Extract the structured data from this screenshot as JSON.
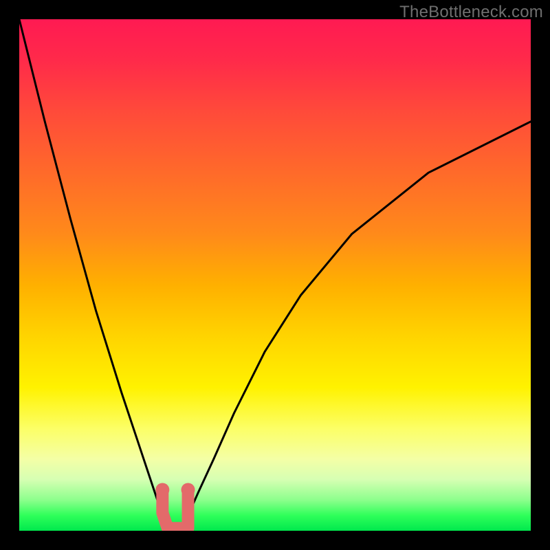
{
  "watermark": "TheBottleneck.com",
  "colors": {
    "background": "#000000",
    "curve": "#000000",
    "marker": "#e36a6a",
    "watermark": "#6f6f6f"
  },
  "chart_data": {
    "type": "line",
    "title": "",
    "xlabel": "",
    "ylabel": "",
    "xlim": [
      0,
      100
    ],
    "ylim": [
      0,
      100
    ],
    "grid": false,
    "legend": false,
    "series": [
      {
        "name": "bottleneck-curve",
        "x": [
          0,
          5,
          10,
          15,
          20,
          23,
          25,
          27,
          28,
          29,
          30,
          31,
          32,
          33,
          35,
          38,
          42,
          48,
          55,
          65,
          80,
          100
        ],
        "values": [
          100,
          80,
          61,
          43,
          27,
          18,
          12,
          6,
          3,
          1,
          0,
          0,
          1,
          3,
          7.5,
          14,
          23,
          35,
          46,
          58,
          70,
          80
        ]
      }
    ],
    "markers": [
      {
        "name": "optimal-range-left",
        "x": 28,
        "y": 3.5
      },
      {
        "name": "optimal-range-right",
        "x": 33,
        "y": 3.5
      },
      {
        "name": "optimal-range-floor-a",
        "x": 29,
        "y": 0.5
      },
      {
        "name": "optimal-range-floor-b",
        "x": 31,
        "y": 0.5
      },
      {
        "name": "optimal-range-floor-c",
        "x": 33,
        "y": 0.5
      }
    ]
  }
}
